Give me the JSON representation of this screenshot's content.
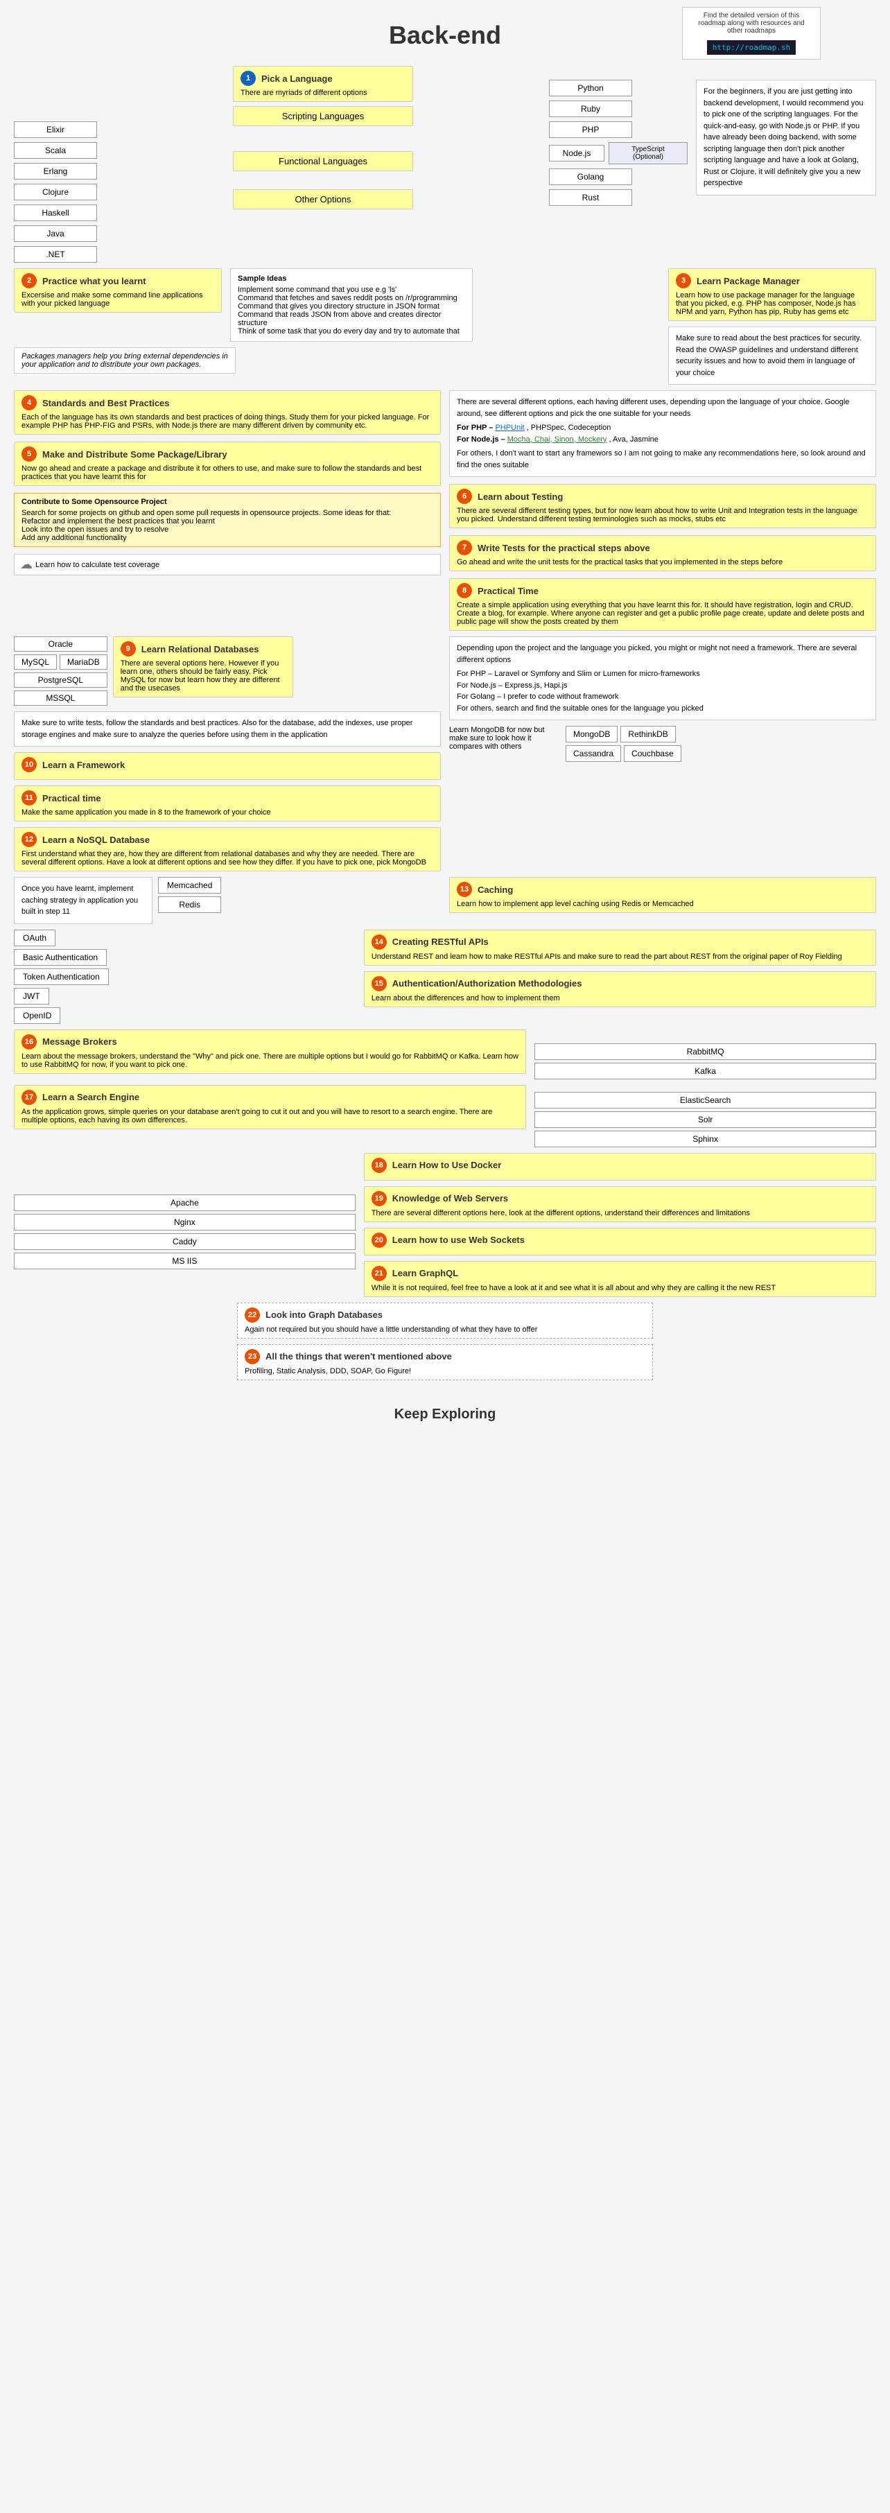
{
  "header": {
    "info_text": "Find the detailed version of this roadmap along with resources and other roadmaps",
    "url": "http://roadmap.sh",
    "title": "Back-end"
  },
  "step1": {
    "circle": "1",
    "title": "Pick a Language",
    "subtitle": "There are myriads of different options",
    "languages_left": [
      "Elixir",
      "Scala",
      "Erlang",
      "Clojure",
      "Haskell",
      "Java",
      ".NET"
    ],
    "languages_right": [
      "Python",
      "Ruby",
      "PHP",
      "Node.js",
      "Golang",
      "Rust"
    ],
    "typescript_optional": "TypeScript (Optional)",
    "functional_label": "Functional Languages",
    "scripting_label": "Scripting Languages",
    "other_label": "Other Options"
  },
  "step1_note": {
    "text": "For the beginners, if you are just getting into backend development, I would recommend you to pick one of the scripting languages. For the quick-and-easy, go with Node.js or PHP. If you have already been doing backend, with some scripting language then don't pick another scripting language and have a look at Golang, Rust or Clojure, it will definitely give you a new perspective"
  },
  "step2": {
    "circle": "2",
    "title": "Practice what you learnt",
    "subtitle": "Excersise and make some command line applications with your picked language"
  },
  "sample_ideas": {
    "title": "Sample Ideas",
    "items": [
      "Implement some command that you use e.g 'ls'",
      "Command that fetches and saves reddit posts on /r/programming",
      "Command that gives you directory structure in JSON format",
      "Command that reads JSON from above and creates director structure",
      "Think of some task that you do every day and try to automate that"
    ]
  },
  "packages_note": "Packages managers help you bring external dependencies in your application and to distribute your own packages.",
  "step3": {
    "circle": "3",
    "title": "Learn Package Manager",
    "text": "Learn how to use package manager for the language that you picked, e.g. PHP has composer, Node.js has NPM and yarn, Python has pip, Ruby has gems etc"
  },
  "security_note": "Make sure to read about the best practices for security. Read the OWASP guidelines and understand different security issues and how to avoid them in language of your choice",
  "step4": {
    "circle": "4",
    "title": "Standards and Best Practices",
    "text": "Each of the language has its own standards and best practices of doing things. Study them for your picked language. For example PHP has PHP-FIG and PSRs, with Node.js there are many different driven by community etc."
  },
  "step5": {
    "circle": "5",
    "title": "Make and Distribute Some Package/Library",
    "text": "Now go ahead and create a package and distribute it for others to use, and make sure to follow the standards and best practices that you have learnt this for"
  },
  "step5b": {
    "title": "Contribute to Some Opensource Project",
    "text": "Search for some projects on github and open some pull requests in opensource projects. Some ideas for that:",
    "items": [
      "Refactor and implement the best practices that you learnt",
      "Look into the open issues and try to resolve",
      "Add any additional functionality"
    ]
  },
  "options_note": {
    "text": "There are several different options, each having different uses, depending upon the language of your choice. Google around, see different options and pick the one suitable for your needs",
    "php_label": "For PHP –",
    "php_link": "PHPUnit",
    "php_rest": ", PHPSpec, Codeception",
    "nodejs_label": "For Node.js –",
    "nodejs_link": "Mocha, Chai, Sinon, Mockery",
    "nodejs_rest": ", Ava, Jasmine",
    "others": "For others, I don't want to start any framewors so I am not going to make any recommendations here, so look around and find the ones suitable"
  },
  "learn_coverage": "Learn how to calculate test coverage",
  "step6": {
    "circle": "6",
    "title": "Learn about Testing",
    "text": "There are several different testing types, but for now learn about how to write Unit and Integration tests in the language you picked. Understand different testing terminologies such as mocks, stubs etc"
  },
  "step7": {
    "circle": "7",
    "title": "Write Tests for the practical steps above",
    "text": "Go ahead and write the unit tests for the practical tasks that you implemented in the steps before"
  },
  "step8": {
    "circle": "8",
    "title": "Practical Time",
    "text": "Create a simple application using everything that you have learnt this for. It should have registration, login and CRUD. Create a blog, for example. Where anyone can register and get a public profile page create, update and delete posts and public page will show the posts created by them"
  },
  "relational_db": {
    "circle": "9",
    "title": "Learn Relational Databases",
    "text": "There are several options here. However if you learn one, others should be fairly easy. Pick MySQL for now but learn how they are different and the usecases",
    "items": [
      "Oracle",
      "MySQL",
      "MariaDB",
      "PostgreSQL",
      "MSSQL"
    ]
  },
  "db_best_practices": "Make sure to write tests, follow the standards and best practices. Also for the database, add the indexes, use proper storage engines and make sure to analyze the queries before using them in the application",
  "framework_step": {
    "circle": "10",
    "title": "Learn a Framework"
  },
  "practical_time2": {
    "circle": "11",
    "title": "Practical time",
    "text": "Make the same application you made in 8 to the framework of your choice"
  },
  "nosql_step": {
    "circle": "12",
    "title": "Learn a NoSQL Database",
    "text": "First understand what they are, how they are different from relational databases and why they are needed. There are several different options. Have a look at different options and see how they differ. If you have to pick one, pick MongoDB",
    "items": [
      "MongoDB",
      "RethinkDB",
      "Cassandra",
      "Couchbase"
    ],
    "learn_label": "Learn MongoDB for now but make sure to look how it compares with others"
  },
  "caching_step": {
    "circle": "13",
    "title": "Caching",
    "text": "Learn how to implement app level caching using Redis or Memcached",
    "items": [
      "Memcached",
      "Redis"
    ]
  },
  "caching_note": "Once you have learnt, implement caching strategy in application you built in step 11",
  "restful_step": {
    "circle": "14",
    "title": "Creating RESTful APIs",
    "text": "Understand REST and learn how to make RESTful APIs and make sure to read the part about REST from the original paper of Roy Fielding"
  },
  "auth_step": {
    "circle": "15",
    "title": "Authentication/Authorization Methodologies",
    "text": "Learn about the differences and how to implement them",
    "items": [
      "OAuth",
      "Basic Authentication",
      "Token Authentication",
      "JWT",
      "OpenID"
    ]
  },
  "message_brokers": {
    "circle": "16",
    "title": "Message Brokers",
    "text": "Learn about the message brokers, understand the \"Why\" and pick one. There are multiple options but I would go for RabbitMQ or Kafka. Learn how to use RabbitMQ for now, if you want to pick one.",
    "items": [
      "RabbitMQ",
      "Kafka"
    ]
  },
  "search_engine": {
    "circle": "17",
    "title": "Learn a Search Engine",
    "text": "As the application grows, simple queries on your database aren't going to cut it out and you will have to resort to a search engine. There are multiple options, each having its own differences.",
    "items": [
      "ElasticSearch",
      "Solr",
      "Sphinx"
    ]
  },
  "docker_step": {
    "circle": "18",
    "title": "Learn How to Use Docker"
  },
  "web_servers": {
    "circle": "19",
    "title": "Knowledge of Web Servers",
    "text": "There are several different options here, look at the different options, understand their differences and limitations",
    "items": [
      "Apache",
      "Nginx",
      "Caddy",
      "MS IIS"
    ]
  },
  "websockets_step": {
    "circle": "20",
    "title": "Learn how to use Web Sockets"
  },
  "graphql_step": {
    "circle": "21",
    "title": "Learn GraphQL",
    "text": "While it is not required, feel free to have a look at it and see what it is all about and why they are calling it the new REST"
  },
  "graph_db_step": {
    "circle": "22",
    "title": "Look into Graph Databases",
    "text": "Again not required but you should have a little understanding of what they have to offer"
  },
  "all_things_step": {
    "circle": "23",
    "title": "All the things that weren't mentioned above",
    "text": "Profiling, Static Analysis, DDD, SOAP, Go Figure!"
  },
  "framework_note": {
    "text": "Depending upon the project and the language you picked, you might or might not need a framework. There are several different options",
    "php": "For PHP – Laravel or Symfony and Slim or Lumen for micro-frameworks",
    "nodejs": "For Node.js – Express.js, Hapi.js",
    "golang": "For Golang – I prefer to code without framework",
    "others": "For others, search and find the suitable ones for the language you picked"
  },
  "footer": {
    "title": "Keep Exploring"
  }
}
